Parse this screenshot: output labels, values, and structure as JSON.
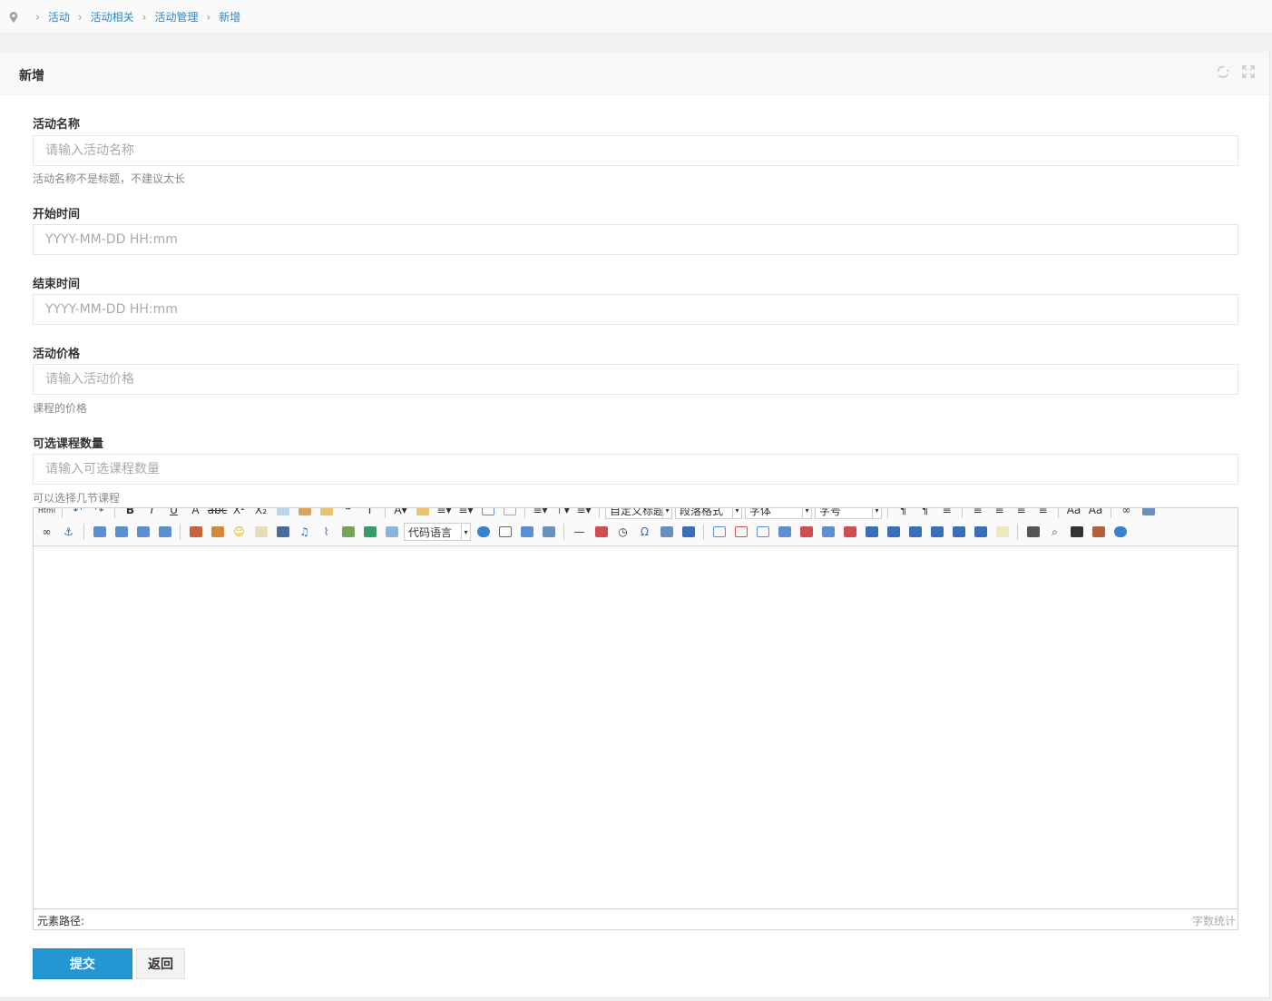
{
  "breadcrumb": {
    "items": [
      "活动",
      "活动相关",
      "活动管理",
      "新增"
    ]
  },
  "panel": {
    "title": "新增"
  },
  "form": {
    "name": {
      "label": "活动名称",
      "placeholder": "请输入活动名称",
      "help": "活动名称不是标题，不建议太长"
    },
    "start": {
      "label": "开始时间",
      "placeholder": "YYYY-MM-DD HH:mm"
    },
    "end": {
      "label": "结束时间",
      "placeholder": "YYYY-MM-DD HH:mm"
    },
    "price": {
      "label": "活动价格",
      "placeholder": "请输入活动价格",
      "help": "课程的价格"
    },
    "count": {
      "label": "可选课程数量",
      "placeholder": "请输入可选课程数量",
      "help": "可以选择几节课程"
    }
  },
  "editor": {
    "combos_row1": [
      "自定义标题",
      "段落格式",
      "字体",
      "字号"
    ],
    "combo_code": "代码语言",
    "footer_path": "元素路径:",
    "footer_count": "字数统计"
  },
  "actions": {
    "submit": "提交",
    "back": "返回"
  },
  "colors": {
    "link": "#2b8bc6",
    "primary": "#2497d3"
  }
}
